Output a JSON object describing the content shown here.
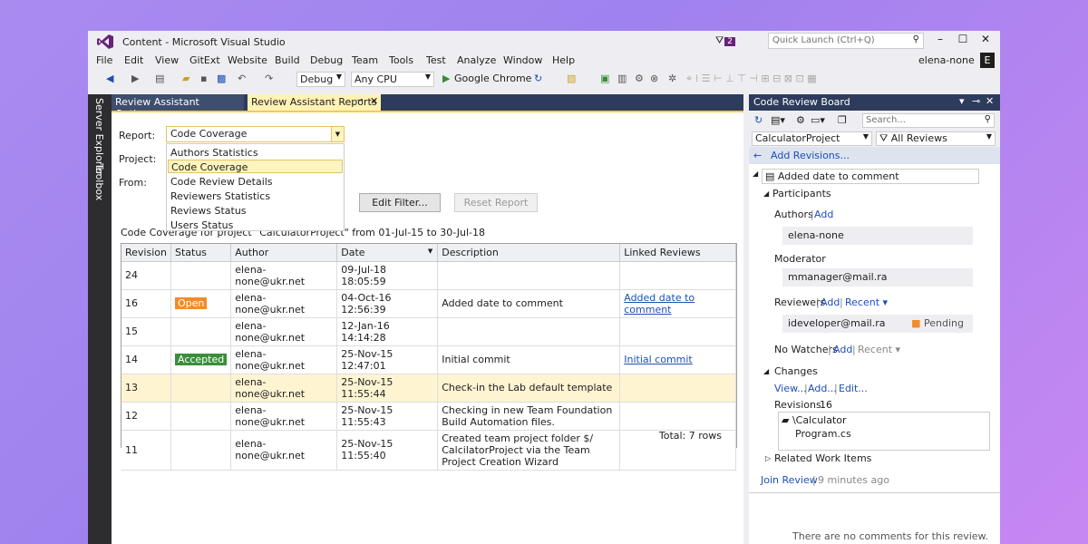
{
  "window": {
    "title": "Content - Microsoft Visual Studio",
    "notif_count": "2",
    "quick_launch_placeholder": "Quick Launch (Ctrl+Q)",
    "user": "elena-none",
    "user_initial": "E"
  },
  "menu": [
    "File",
    "Edit",
    "View",
    "GitExt",
    "Website",
    "Build",
    "Debug",
    "Team",
    "Tools",
    "Test",
    "Analyze",
    "Window",
    "Help"
  ],
  "toolbar": {
    "config": "Debug",
    "platform": "Any CPU",
    "run_target": "Google Chrome"
  },
  "side_tabs": [
    "Server Explorer",
    "Toolbox"
  ],
  "doc_tabs": [
    "Review Assistant Options",
    "Review Assistant Reports"
  ],
  "report": {
    "report_label": "Report:",
    "project_label": "Project:",
    "from_label": "From:",
    "selected": "Code Coverage",
    "options": [
      "Authors Statistics",
      "Code Coverage",
      "Code Review Details",
      "Reviewers Statistics",
      "Reviews Status",
      "Users Status"
    ],
    "edit_filter": "Edit Filter...",
    "reset_report": "Reset Report",
    "caption": "Code Coverage for project \"CalculatorProject\" from 01-Jul-15 to 30-Jul-18",
    "columns": [
      "Revision",
      "Status",
      "Author",
      "Date",
      "Description",
      "Linked Reviews"
    ],
    "rows": [
      {
        "revision": "24",
        "status": "",
        "author": "elena-none@ukr.net",
        "date": "09-Jul-18 18:05:59",
        "description": "",
        "linked": ""
      },
      {
        "revision": "16",
        "status": "Open",
        "author": "elena-none@ukr.net",
        "date": "04-Oct-16 12:56:39",
        "description": "Added date to comment",
        "linked": "Added date to comment"
      },
      {
        "revision": "15",
        "status": "",
        "author": "elena-none@ukr.net",
        "date": "12-Jan-16 14:14:28",
        "description": "",
        "linked": ""
      },
      {
        "revision": "14",
        "status": "Accepted",
        "author": "elena-none@ukr.net",
        "date": "25-Nov-15 12:47:01",
        "description": "Initial commit",
        "linked": "Initial commit"
      },
      {
        "revision": "13",
        "status": "",
        "author": "elena-none@ukr.net",
        "date": "25-Nov-15 11:55:44",
        "description": "Check-in the Lab default template",
        "linked": ""
      },
      {
        "revision": "12",
        "status": "",
        "author": "elena-none@ukr.net",
        "date": "25-Nov-15 11:55:43",
        "description": "Checking in new Team Foundation Build Automation files.",
        "linked": ""
      },
      {
        "revision": "11",
        "status": "",
        "author": "elena-none@ukr.net",
        "date": "25-Nov-15 11:55:40",
        "description": "Created team project folder $/ CalcilatorProject via the Team Project Creation Wizard",
        "linked": ""
      }
    ],
    "total": "Total: 7 rows"
  },
  "colors": {
    "open": "#f28c28",
    "accepted": "#3b8e3b",
    "pending": "#f28c28"
  },
  "board": {
    "title": "Code Review Board",
    "search_placeholder": "Search...",
    "project": "CalculatorProject",
    "filter": "All Reviews",
    "add_revisions": "Add Revisions...",
    "review_title": "Added date to comment",
    "participants": "Participants",
    "authors_label": "Authors",
    "add": "Add",
    "author": "elena-none",
    "moderator_label": "Moderator",
    "moderator": "mmanager@mail.ra",
    "reviewers_label": "Reviewers",
    "recent": "Recent",
    "reviewer": "ideveloper@mail.ra",
    "pending": "Pending",
    "watchers_label": "No Watchers",
    "changes": "Changes",
    "view": "View...",
    "add_change": "Add...",
    "edit": "Edit...",
    "revisions_label": "Revisions:",
    "revisions_value": "16",
    "folder": "\\Calculator",
    "file": "Program.cs",
    "related": "Related Work Items",
    "join": "Join Review",
    "time": "9 minutes ago",
    "no_comments": "There are no comments for this review."
  }
}
